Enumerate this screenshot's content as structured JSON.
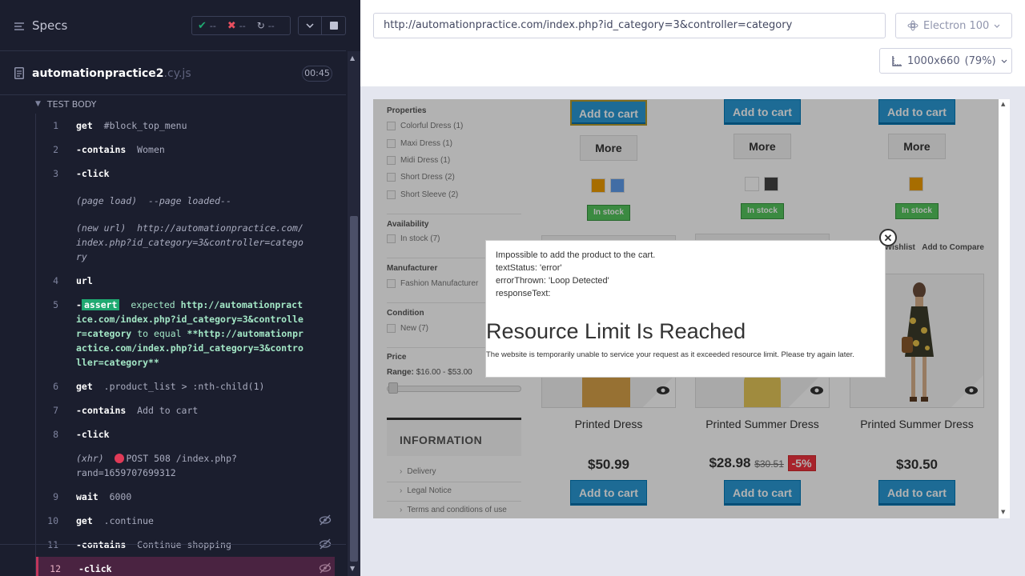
{
  "runner": {
    "specs_label": "Specs",
    "stats": {
      "passed": "--",
      "failed": "--",
      "pending": "--"
    },
    "file": {
      "name": "automationpractice2",
      "ext": ".cy.js",
      "duration": "00:45"
    },
    "test_body_label": "TEST BODY",
    "commands": [
      {
        "num": "1",
        "name": "get",
        "msg": "#block_top_menu"
      },
      {
        "num": "2",
        "name": "-contains",
        "msg": "Women"
      },
      {
        "num": "3",
        "name": "-click",
        "msg": ""
      },
      {
        "num": "",
        "name": "(page load)",
        "msg": "--page loaded--"
      },
      {
        "num": "",
        "name": "(new url)",
        "msg": "http://automationpractice.com/index.php?id_category=3&controller=category"
      },
      {
        "num": "4",
        "name": "url",
        "msg": ""
      },
      {
        "num": "5",
        "name": "assert",
        "msg_prefix": "expected",
        "msg_a": "http://automationpractice.com/index.php?id_category=3&controller=category",
        "msg_mid": "to equal",
        "msg_b": "**http://automationpractice.com/index.php?id_category=3&controller=category**"
      },
      {
        "num": "6",
        "name": "get",
        "msg": ".product_list > :nth-child(1)"
      },
      {
        "num": "7",
        "name": "-contains",
        "msg": "Add to cart"
      },
      {
        "num": "8",
        "name": "-click",
        "msg": ""
      },
      {
        "num": "",
        "name": "(xhr)",
        "msg": "POST 508 /index.php?rand=1659707699312"
      },
      {
        "num": "9",
        "name": "wait",
        "msg": "6000"
      },
      {
        "num": "10",
        "name": "get",
        "msg": ".continue"
      },
      {
        "num": "11",
        "name": "-contains",
        "msg": "Continue shopping"
      },
      {
        "num": "12",
        "name": "-click",
        "msg": ""
      }
    ]
  },
  "browser": {
    "url": "http://automationpractice.com/index.php?id_category=3&controller=category",
    "name": "Electron 100",
    "viewport": "1000x660",
    "scale": "(79%)"
  },
  "aut": {
    "sidebar": {
      "properties_title": "Properties",
      "properties": [
        "Colorful Dress (1)",
        "Maxi Dress (1)",
        "Midi Dress (1)",
        "Short Dress (2)",
        "Short Sleeve (2)"
      ],
      "availability_title": "Availability",
      "availability": [
        "In stock (7)"
      ],
      "manufacturer_title": "Manufacturer",
      "manufacturer": [
        "Fashion Manufacturer"
      ],
      "condition_title": "Condition",
      "condition": [
        "New (7)"
      ],
      "price_title": "Price",
      "range_label": "Range:",
      "range_value": "$16.00 - $53.00",
      "information_title": "INFORMATION",
      "info_links": [
        "Delivery",
        "Legal Notice",
        "Terms and conditions of use"
      ]
    },
    "products_top": [
      {
        "cart": "Add to cart",
        "more": "More",
        "stock": "In stock",
        "swatches": [
          "#f09c00",
          "#5d9cec"
        ]
      },
      {
        "cart": "Add to cart",
        "more": "More",
        "stock": "In stock",
        "swatches": [
          "#ffffff",
          "#434343"
        ]
      },
      {
        "cart": "Add to cart",
        "more": "More",
        "stock": "In stock",
        "swatches": [
          "#f09c00"
        ]
      }
    ],
    "wishlist_label": "Wishlist",
    "compare_label": "Add to Compare",
    "products_bottom": [
      {
        "name": "Printed Dress",
        "price": "$50.99",
        "old": "",
        "discount": "",
        "cart": "Add to cart"
      },
      {
        "name": "Printed Summer Dress",
        "price": "$28.98",
        "old": "$30.51",
        "discount": "-5%",
        "cart": "Add to cart"
      },
      {
        "name": "Printed Summer Dress",
        "price": "$30.50",
        "old": "",
        "discount": "",
        "cart": "Add to cart"
      }
    ],
    "dialog": {
      "line1": "Impossible to add the product to the cart.",
      "line2": "textStatus: 'error'",
      "line3": "errorThrown: 'Loop Detected'",
      "line4": "responseText:",
      "heading": "Resource Limit Is Reached",
      "body": "The website is temporarily unable to service your request as it exceeded resource limit. Please try again later."
    }
  },
  "colors": {
    "pass": "#1fa971",
    "fail": "#e94f5f",
    "active_row": "#4a2341",
    "cart_blue": "#2a9ad6",
    "stock_green": "#55c65e"
  }
}
